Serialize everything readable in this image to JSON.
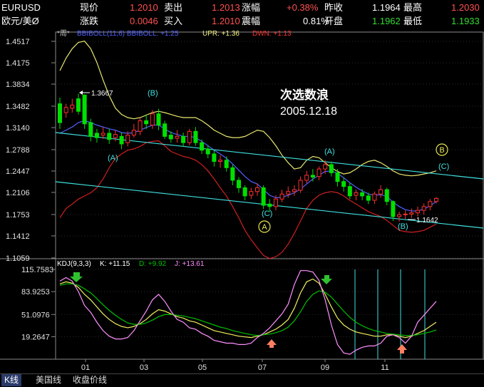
{
  "quote": {
    "symbol": "EURUSD",
    "name": "欧元/美Ø",
    "row1": {
      "l1": "现价",
      "v1": "1.2010",
      "l2": "卖出",
      "v2": "1.2013",
      "l3": "涨幅",
      "v3": "+0.38%",
      "l4": "昨收",
      "v4": "1.1964",
      "l5": "最高",
      "v5": "1.2030"
    },
    "row2": {
      "l1": "涨跌",
      "v1": "0.0046",
      "l2": "买入",
      "v2": "1.2010",
      "l3": "震幅",
      "v3": "0.81%",
      "l4": "开盘",
      "v4": "1.1962",
      "l5": "最低",
      "v5": "1.1933"
    }
  },
  "main_chart": {
    "period_tag": "*周*",
    "indicator": "BBIBOLL(11,6) BBIBOLL: +1.25",
    "upr": "UPR: +1.36",
    "dwn": "DWN: +1.13",
    "y_ticks": [
      "1.4517",
      "1.4175",
      "1.3834",
      "1.3482",
      "1.3140",
      "1.2788",
      "1.2447",
      "1.2106",
      "1.1753",
      "1.1412",
      "1.1059"
    ],
    "title_line1": "次选数浪",
    "title_line2": "2005.12.18",
    "high_label": "1.3667",
    "low_label": "1.1642",
    "wave_labels": [
      "(A)",
      "(B)",
      "(A)",
      "(C)",
      "(B)",
      "(C)"
    ],
    "circle_labels": [
      "A",
      "B"
    ]
  },
  "kdj_chart": {
    "header": "KDJ(9,3,3)",
    "k": "K: +11.15",
    "d": "D: +9.92",
    "j": "J: +13.61",
    "y_ticks": [
      "115.7583",
      "83.9253",
      "51.0976",
      "19.2647"
    ]
  },
  "x_axis": [
    "01",
    "03",
    "05",
    "07",
    "09",
    "11"
  ],
  "tabs": [
    "K线",
    "美国线",
    "收盘价线"
  ],
  "colors": {
    "up": "#ff3030",
    "down": "#00e000",
    "mid": "#5060ff",
    "upper": "#e8e870",
    "lower": "#d02020",
    "channel": "#40e0e0",
    "k": "#ffffff",
    "d": "#00c000",
    "j": "#ff90ff"
  },
  "chart_data": {
    "type": "candlestick",
    "candles": [
      [
        1.352,
        1.322,
        1.362,
        1.312
      ],
      [
        1.338,
        1.346,
        1.352,
        1.33
      ],
      [
        1.345,
        1.35,
        1.36,
        1.338
      ],
      [
        1.36,
        1.34,
        1.368,
        1.335
      ],
      [
        1.366,
        1.32,
        1.367,
        1.312
      ],
      [
        1.322,
        1.3,
        1.328,
        1.292
      ],
      [
        1.305,
        1.298,
        1.312,
        1.29
      ],
      [
        1.302,
        1.305,
        1.315,
        1.296
      ],
      [
        1.305,
        1.295,
        1.312,
        1.288
      ],
      [
        1.298,
        1.303,
        1.31,
        1.292
      ],
      [
        1.3,
        1.288,
        1.306,
        1.28
      ],
      [
        1.29,
        1.302,
        1.308,
        1.284
      ],
      [
        1.302,
        1.31,
        1.32,
        1.298
      ],
      [
        1.308,
        1.325,
        1.33,
        1.302
      ],
      [
        1.325,
        1.32,
        1.335,
        1.312
      ],
      [
        1.318,
        1.336,
        1.342,
        1.312
      ],
      [
        1.336,
        1.318,
        1.344,
        1.31
      ],
      [
        1.32,
        1.3,
        1.325,
        1.296
      ],
      [
        1.302,
        1.296,
        1.308,
        1.29
      ],
      [
        1.297,
        1.3,
        1.31,
        1.29
      ],
      [
        1.3,
        1.29,
        1.306,
        1.284
      ],
      [
        1.29,
        1.308,
        1.312,
        1.286
      ],
      [
        1.308,
        1.29,
        1.315,
        1.285
      ],
      [
        1.29,
        1.278,
        1.295,
        1.272
      ],
      [
        1.28,
        1.272,
        1.286,
        1.265
      ],
      [
        1.272,
        1.26,
        1.278,
        1.252
      ],
      [
        1.26,
        1.262,
        1.27,
        1.25
      ],
      [
        1.262,
        1.25,
        1.268,
        1.244
      ],
      [
        1.25,
        1.23,
        1.255,
        1.222
      ],
      [
        1.23,
        1.218,
        1.235,
        1.21
      ],
      [
        1.218,
        1.205,
        1.222,
        1.198
      ],
      [
        1.206,
        1.212,
        1.218,
        1.2
      ],
      [
        1.212,
        1.218,
        1.225,
        1.205
      ],
      [
        1.218,
        1.19,
        1.222,
        1.184
      ],
      [
        1.192,
        1.188,
        1.2,
        1.18
      ],
      [
        1.188,
        1.2,
        1.206,
        1.182
      ],
      [
        1.2,
        1.208,
        1.215,
        1.195
      ],
      [
        1.208,
        1.212,
        1.22,
        1.202
      ],
      [
        1.212,
        1.215,
        1.222,
        1.205
      ],
      [
        1.214,
        1.23,
        1.236,
        1.21
      ],
      [
        1.23,
        1.238,
        1.245,
        1.225
      ],
      [
        1.238,
        1.235,
        1.248,
        1.228
      ],
      [
        1.236,
        1.248,
        1.252,
        1.23
      ],
      [
        1.248,
        1.255,
        1.262,
        1.24
      ],
      [
        1.255,
        1.242,
        1.26,
        1.236
      ],
      [
        1.242,
        1.228,
        1.248,
        1.22
      ],
      [
        1.228,
        1.22,
        1.234,
        1.212
      ],
      [
        1.22,
        1.205,
        1.226,
        1.2
      ],
      [
        1.206,
        1.21,
        1.215,
        1.198
      ],
      [
        1.21,
        1.205,
        1.216,
        1.198
      ],
      [
        1.205,
        1.198,
        1.21,
        1.192
      ],
      [
        1.198,
        1.208,
        1.212,
        1.192
      ],
      [
        1.208,
        1.215,
        1.222,
        1.202
      ],
      [
        1.215,
        1.196,
        1.218,
        1.19
      ],
      [
        1.196,
        1.172,
        1.198,
        1.165
      ],
      [
        1.172,
        1.175,
        1.18,
        1.164
      ],
      [
        1.175,
        1.176,
        1.182,
        1.168
      ],
      [
        1.176,
        1.178,
        1.185,
        1.17
      ],
      [
        1.178,
        1.182,
        1.188,
        1.172
      ],
      [
        1.182,
        1.188,
        1.193,
        1.175
      ],
      [
        1.188,
        1.196,
        1.2,
        1.182
      ],
      [
        1.196,
        1.201,
        1.203,
        1.193
      ]
    ],
    "series": [
      {
        "name": "BBIBOLL",
        "values": [
          1.305,
          1.31,
          1.315,
          1.322,
          1.325,
          1.322,
          1.318,
          1.315,
          1.312,
          1.31,
          1.306,
          1.305,
          1.306,
          1.31,
          1.314,
          1.318,
          1.318,
          1.312,
          1.306,
          1.303,
          1.3,
          1.3,
          1.298,
          1.292,
          1.285,
          1.278,
          1.272,
          1.265,
          1.256,
          1.246,
          1.236,
          1.228,
          1.224,
          1.215,
          1.206,
          1.202,
          1.203,
          1.206,
          1.21,
          1.216,
          1.224,
          1.232,
          1.238,
          1.244,
          1.245,
          1.241,
          1.234,
          1.226,
          1.219,
          1.213,
          1.208,
          1.206,
          1.207,
          1.204,
          1.195,
          1.188,
          1.183,
          1.181,
          1.181,
          1.184,
          1.189,
          1.196
        ]
      },
      {
        "name": "UPR",
        "values": [
          1.405,
          1.425,
          1.44,
          1.45,
          1.452,
          1.44,
          1.418,
          1.39,
          1.365,
          1.345,
          1.335,
          1.33,
          1.328,
          1.33,
          1.334,
          1.338,
          1.34,
          1.338,
          1.335,
          1.332,
          1.33,
          1.33,
          1.33,
          1.325,
          1.318,
          1.31,
          1.305,
          1.3,
          1.298,
          1.298,
          1.3,
          1.305,
          1.31,
          1.308,
          1.298,
          1.285,
          1.27,
          1.258,
          1.248,
          1.25,
          1.262,
          1.268,
          1.266,
          1.258,
          1.25,
          1.244,
          1.24,
          1.242,
          1.248,
          1.255,
          1.26,
          1.262,
          1.258,
          1.252,
          1.245,
          1.24,
          1.238,
          1.237,
          1.238,
          1.24,
          1.242,
          1.245
        ]
      },
      {
        "name": "DWN",
        "values": [
          1.17,
          1.185,
          1.192,
          1.2,
          1.205,
          1.21,
          1.218,
          1.232,
          1.25,
          1.265,
          1.272,
          1.278,
          1.28,
          1.284,
          1.29,
          1.292,
          1.293,
          1.285,
          1.276,
          1.272,
          1.268,
          1.266,
          1.262,
          1.255,
          1.245,
          1.232,
          1.218,
          1.205,
          1.188,
          1.17,
          1.15,
          1.135,
          1.122,
          1.11,
          1.105,
          1.108,
          1.115,
          1.128,
          1.145,
          1.165,
          1.185,
          1.198,
          1.206,
          1.21,
          1.212,
          1.21,
          1.205,
          1.198,
          1.192,
          1.186,
          1.18,
          1.176,
          1.172,
          1.166,
          1.158,
          1.15,
          1.148,
          1.147,
          1.148,
          1.15,
          1.155,
          1.16
        ]
      },
      {
        "name": "K",
        "values": [
          95,
          98,
          96,
          90,
          80,
          72,
          62,
          52,
          44,
          38,
          34,
          32,
          34,
          38,
          44,
          52,
          58,
          56,
          52,
          48,
          46,
          42,
          40,
          36,
          32,
          28,
          26,
          24,
          22,
          20,
          19,
          18,
          20,
          22,
          26,
          30,
          36,
          44,
          60,
          82,
          98,
          102,
          96,
          80,
          62,
          46,
          36,
          30,
          26,
          24,
          22,
          20,
          20,
          22,
          22,
          20,
          18,
          20,
          24,
          28,
          34,
          40
        ]
      },
      {
        "name": "D",
        "values": [
          93,
          95,
          95,
          93,
          88,
          82,
          74,
          65,
          57,
          50,
          44,
          39,
          37,
          37,
          39,
          43,
          48,
          51,
          51,
          50,
          49,
          47,
          45,
          42,
          39,
          36,
          33,
          31,
          28,
          26,
          24,
          22,
          21,
          22,
          23,
          25,
          28,
          33,
          42,
          55,
          70,
          80,
          85,
          83,
          76,
          66,
          56,
          47,
          40,
          35,
          31,
          28,
          26,
          24,
          23,
          22,
          21,
          21,
          22,
          24,
          26,
          29
        ]
      },
      {
        "name": "J",
        "values": [
          99,
          104,
          99,
          84,
          64,
          54,
          40,
          28,
          20,
          16,
          16,
          18,
          28,
          42,
          56,
          72,
          80,
          70,
          56,
          44,
          40,
          32,
          30,
          24,
          20,
          14,
          12,
          10,
          10,
          8,
          8,
          10,
          18,
          24,
          32,
          42,
          52,
          66,
          94,
          114,
          114,
          112,
          100,
          72,
          36,
          8,
          -4,
          -6,
          0,
          4,
          6,
          6,
          10,
          20,
          22,
          18,
          10,
          20,
          40,
          50,
          60,
          70
        ]
      }
    ],
    "x_ticks": [
      "01",
      "03",
      "05",
      "07",
      "09",
      "11"
    ],
    "ylim": [
      1.1059,
      1.4517
    ],
    "kdj_ylim": [
      -12,
      115.7583
    ]
  }
}
